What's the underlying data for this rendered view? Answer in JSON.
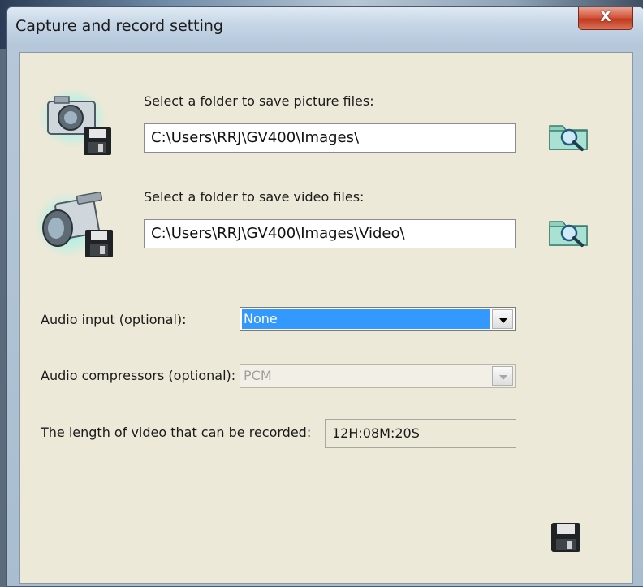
{
  "window": {
    "title": "Capture and record setting",
    "close_label": "X"
  },
  "picture": {
    "label": "Select a folder to save picture files:",
    "path": "C:\\Users\\RRJ\\GV400\\Images\\",
    "camera_icon": "camera-save-icon",
    "browse_icon": "folder-search-icon"
  },
  "video": {
    "label": "Select a folder to save video files:",
    "path": "C:\\Users\\RRJ\\GV400\\Images\\Video\\",
    "camera_icon": "camcorder-save-icon",
    "browse_icon": "folder-search-icon"
  },
  "audio_input": {
    "label": "Audio input (optional):",
    "value": "None"
  },
  "audio_compressor": {
    "label": "Audio compressors (optional):",
    "value": "PCM"
  },
  "record_length": {
    "label": "The length of video that can be recorded:",
    "value": "12H:08M:20S"
  },
  "save": {
    "icon": "floppy-disk-icon"
  },
  "colors": {
    "selection": "#3399ff",
    "dialog_bg": "#ece9d8",
    "close_button": "#c23a1e"
  }
}
